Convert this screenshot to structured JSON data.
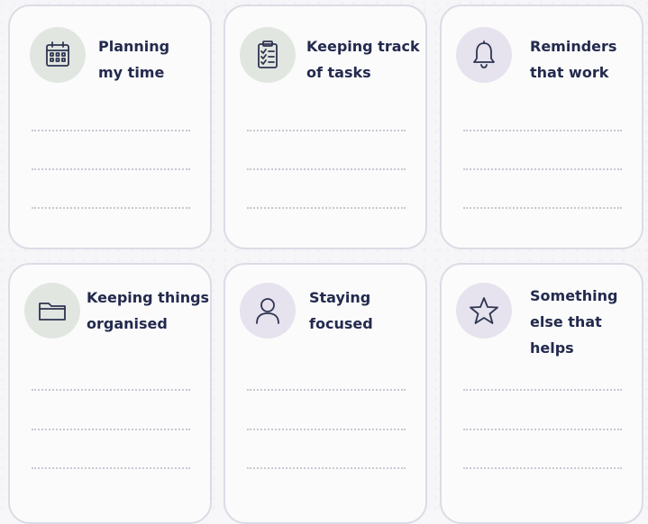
{
  "cards": [
    {
      "id": "planning",
      "title_lines": [
        "Planning",
        "my time"
      ],
      "icon": "calendar-icon"
    },
    {
      "id": "tasks",
      "title_lines": [
        "Keeping track",
        "of tasks"
      ],
      "icon": "clipboard-checklist-icon"
    },
    {
      "id": "reminders",
      "title_lines": [
        "Reminders",
        "that work"
      ],
      "icon": "bell-icon"
    },
    {
      "id": "organised",
      "title_lines": [
        "Keeping things",
        "organised"
      ],
      "icon": "folder-icon"
    },
    {
      "id": "focused",
      "title_lines": [
        "Staying",
        "focused"
      ],
      "icon": "person-icon"
    },
    {
      "id": "else",
      "title_lines": [
        "Something",
        "else that",
        "helps"
      ],
      "icon": "star-icon"
    }
  ],
  "colors": {
    "title": "#232a4d",
    "card_border": "#dcdce6",
    "badge_green": "#e2e6e1",
    "badge_purple": "#e6e2ee",
    "writing_line": "#c8c8d2"
  }
}
